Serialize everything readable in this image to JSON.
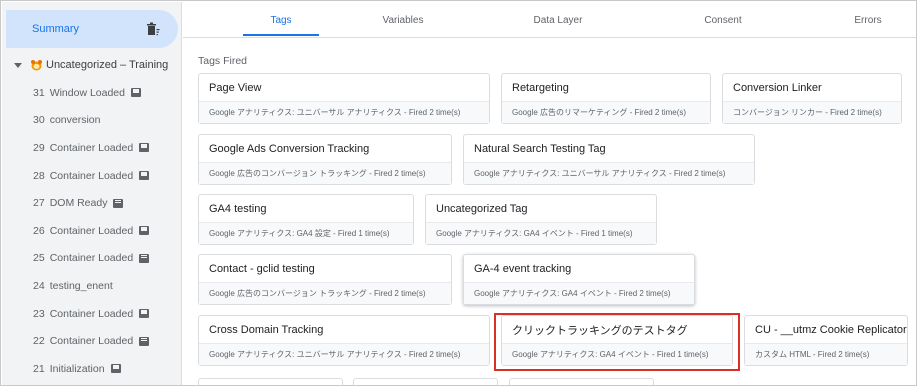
{
  "sidebar": {
    "summary_label": "Summary",
    "container_label": "Uncategorized – Training",
    "events": [
      {
        "num": "31",
        "label": "Window Loaded",
        "badge": true
      },
      {
        "num": "30",
        "label": "conversion",
        "badge": false
      },
      {
        "num": "29",
        "label": "Container Loaded",
        "badge": true
      },
      {
        "num": "28",
        "label": "Container Loaded",
        "badge": true
      },
      {
        "num": "27",
        "label": "DOM Ready",
        "badge": true
      },
      {
        "num": "26",
        "label": "Container Loaded",
        "badge": true
      },
      {
        "num": "25",
        "label": "Container Loaded",
        "badge": true
      },
      {
        "num": "24",
        "label": "testing_enent",
        "badge": false
      },
      {
        "num": "23",
        "label": "Container Loaded",
        "badge": true
      },
      {
        "num": "22",
        "label": "Container Loaded",
        "badge": true
      },
      {
        "num": "21",
        "label": "Initialization",
        "badge": true
      }
    ]
  },
  "tabs": [
    {
      "label": "Tags",
      "active": true
    },
    {
      "label": "Variables",
      "active": false
    },
    {
      "label": "Data Layer",
      "active": false
    },
    {
      "label": "Consent",
      "active": false
    },
    {
      "label": "Errors",
      "active": false
    }
  ],
  "main": {
    "section_title": "Tags Fired",
    "cards": [
      {
        "name": "Page View",
        "meta": "Google アナリティクス: ユニバーサル アナリティクス - Fired 2 time(s)"
      },
      {
        "name": "Retargeting",
        "meta": "Google 広告のリマーケティング - Fired 2 time(s)"
      },
      {
        "name": "Conversion Linker",
        "meta": "コンバージョン リンカー - Fired 2 time(s)"
      },
      {
        "name": "Google Ads Conversion Tracking",
        "meta": "Google 広告のコンバージョン トラッキング - Fired 2 time(s)"
      },
      {
        "name": "Natural Search Testing Tag",
        "meta": "Google アナリティクス: ユニバーサル アナリティクス - Fired 2 time(s)"
      },
      {
        "name": "GA4 testing",
        "meta": "Google アナリティクス: GA4 設定 - Fired 1 time(s)"
      },
      {
        "name": "Uncategorized Tag",
        "meta": "Google アナリティクス: GA4 イベント - Fired 1 time(s)"
      },
      {
        "name": "Contact - gclid testing",
        "meta": "Google 広告のコンバージョン トラッキング - Fired 2 time(s)"
      },
      {
        "name": "GA-4 event tracking",
        "meta": "Google アナリティクス: GA4 イベント - Fired 2 time(s)"
      },
      {
        "name": "Cross Domain Tracking",
        "meta": "Google アナリティクス: ユニバーサル アナリティクス - Fired 2 time(s)"
      },
      {
        "name": "クリックトラッキングのテストタグ",
        "meta": "Google アナリティクス: GA4 イベント - Fired 1 time(s)"
      },
      {
        "name": "CU - __utmz Cookie Replicator",
        "meta": "カスタム HTML - Fired 2 time(s)"
      }
    ]
  },
  "colors": {
    "accent": "#1a73e8",
    "summary_bg": "#d2e3fc",
    "sidebar_bg": "#f1f3f4",
    "highlight": "#d93025"
  }
}
